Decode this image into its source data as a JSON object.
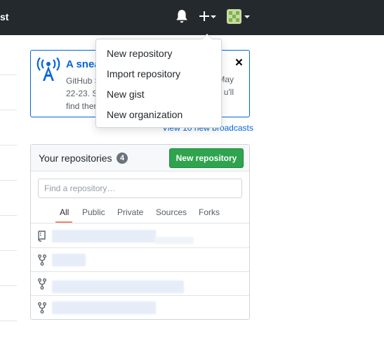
{
  "topbar": {
    "cut_text": "st",
    "icons": {
      "bell": "bell-icon",
      "plus": "plus-icon",
      "avatar": "avatar"
    }
  },
  "dropdown": {
    "items": [
      "New repository",
      "Import repository",
      "New gist",
      "New organization"
    ]
  },
  "broadcast": {
    "title": "A snea",
    "body_line1_left": "GitHub S",
    "body_line1_right": "May",
    "body_line2_left": "22-23. S",
    "body_line2_right": "u'll",
    "body_line3_left": "find ther",
    "close_label": "×",
    "icon": "broadcast-icon",
    "link": "View 10 new broadcasts"
  },
  "repos": {
    "title": "Your repositories",
    "count": "4",
    "new_button": "New repository",
    "search_placeholder": "Find a repository…",
    "tabs": [
      "All",
      "Public",
      "Private",
      "Sources",
      "Forks"
    ],
    "rows": [
      {
        "icon": "repo-icon"
      },
      {
        "icon": "fork-icon"
      },
      {
        "icon": "fork-icon"
      },
      {
        "icon": "fork-icon"
      }
    ]
  },
  "colors": {
    "header": "#24292e",
    "link": "#0366d6",
    "primary_button": "#2ea44f",
    "tab_underline": "#f9826c"
  }
}
